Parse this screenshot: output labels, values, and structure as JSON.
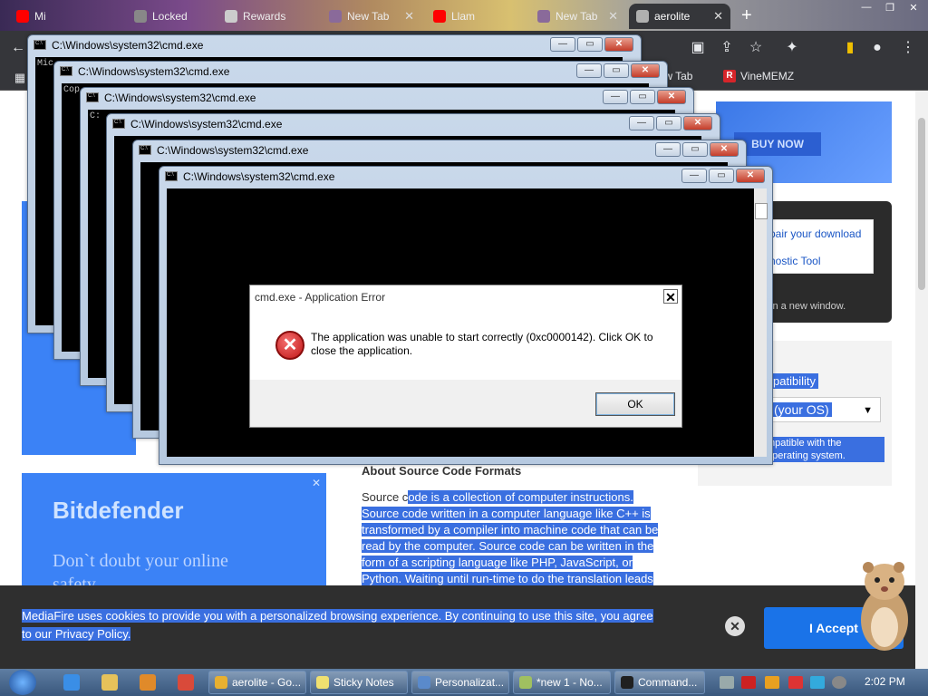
{
  "browser": {
    "tabs": [
      {
        "label": "Mi",
        "color": "#ff0000"
      },
      {
        "label": "Locked",
        "color": "#888888"
      },
      {
        "label": "Rewards",
        "color": "#cccccc"
      },
      {
        "label": "New Tab",
        "color": "#8a6a9a"
      },
      {
        "label": "Llam",
        "color": "#ff0000"
      },
      {
        "label": "New Tab",
        "color": "#8a6a9a"
      },
      {
        "label": "aerolite",
        "color": "#b0b0b0"
      }
    ],
    "new_tab_symbol": "+",
    "bookmarks": [
      {
        "label": "New Tab"
      },
      {
        "label": "VineMEMZ",
        "badge": "R"
      }
    ]
  },
  "page": {
    "ad_top": {
      "button": "BUY NOW"
    },
    "download_panel": {
      "link1": "pair your download",
      "link2": "nostic Tool",
      "note": "in a new window."
    },
    "compat": {
      "label": "patibility",
      "os_select": "(your OS)",
      "note": "mpatible with the operating system."
    },
    "bitdefender": {
      "logo": "Bitdefender",
      "tagline": "Don`t doubt your online safety"
    },
    "about": {
      "heading": "About Source Code Formats",
      "p_lead": "Source c",
      "p_rest": "ode is a collection of computer instructions. Source code written in a computer language like C++ is transformed by a compiler into machine code that can be read by the computer. Source code can be written in the form of a scripting language like PHP, JavaScript, or Python. Waiting until run-time to do the translation leads"
    },
    "cookie": {
      "message": "MediaFire uses cookies to provide you with a personalized browsing experience. By continuing to use this site, you agree to our Privacy Policy.",
      "accept": "I Accept"
    }
  },
  "cmd_windows": {
    "title": "C:\\Windows\\system32\\cmd.exe",
    "console_snippets": [
      "Mic",
      "Cop",
      "C:"
    ]
  },
  "error_dialog": {
    "title": "cmd.exe - Application Error",
    "message": "The application was unable to start correctly (0xc0000142). Click OK to close the application.",
    "ok": "OK"
  },
  "taskbar": {
    "tasks": [
      {
        "label": "aerolite - Go...",
        "color": "#e8b030"
      },
      {
        "label": "Sticky Notes",
        "color": "#f0e070"
      },
      {
        "label": "Personalizat...",
        "color": "#5a8acb"
      },
      {
        "label": "*new 1 - No...",
        "color": "#a0c060"
      },
      {
        "label": "Command...",
        "color": "#202020"
      }
    ],
    "clock": "2:02 PM"
  }
}
